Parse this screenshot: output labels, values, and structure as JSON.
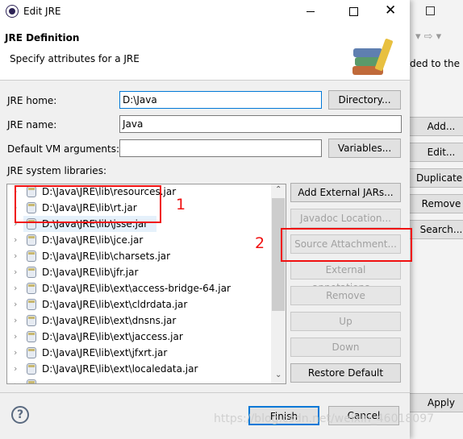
{
  "window": {
    "title": "Edit JRE",
    "minimize_icon": "minimize-icon",
    "maximize_icon": "maximize-icon",
    "close_icon": "close-icon"
  },
  "header": {
    "title": "JRE Definition",
    "subtitle": "Specify attributes for a JRE"
  },
  "form": {
    "jre_home_label": "JRE home:",
    "jre_home_value": "D:\\Java",
    "directory_button": "Directory...",
    "jre_name_label": "JRE name:",
    "jre_name_value": "Java",
    "vm_args_label": "Default VM arguments:",
    "vm_args_value": "",
    "variables_button": "Variables...",
    "libraries_label": "JRE system libraries:"
  },
  "libraries": [
    "D:\\Java\\JRE\\lib\\resources.jar",
    "D:\\Java\\JRE\\lib\\rt.jar",
    "D:\\Java\\JRE\\lib\\jsse.jar",
    "D:\\Java\\JRE\\lib\\jce.jar",
    "D:\\Java\\JRE\\lib\\charsets.jar",
    "D:\\Java\\JRE\\lib\\jfr.jar",
    "D:\\Java\\JRE\\lib\\ext\\access-bridge-64.jar",
    "D:\\Java\\JRE\\lib\\ext\\cldrdata.jar",
    "D:\\Java\\JRE\\lib\\ext\\dnsns.jar",
    "D:\\Java\\JRE\\lib\\ext\\jaccess.jar",
    "D:\\Java\\JRE\\lib\\ext\\jfxrt.jar",
    "D:\\Java\\JRE\\lib\\ext\\localedata.jar"
  ],
  "side_buttons": {
    "add_external": "Add External JARs...",
    "javadoc": "Javadoc Location...",
    "source": "Source Attachment...",
    "annotations": "External annotations...",
    "remove": "Remove",
    "up": "Up",
    "down": "Down",
    "restore": "Restore Default"
  },
  "footer": {
    "finish": "Finish",
    "cancel": "Cancel",
    "help_icon": "help-icon"
  },
  "annotations": {
    "box1_number": "1",
    "box2_number": "2",
    "color": "#f01010"
  },
  "background": {
    "text": "ded to the",
    "add": "Add...",
    "edit": "Edit...",
    "duplicate": "Duplicate...",
    "remove": "Remove",
    "search": "Search...",
    "apply": "Apply"
  },
  "watermark": "https://blog.csdn.net/weixin_46018097"
}
